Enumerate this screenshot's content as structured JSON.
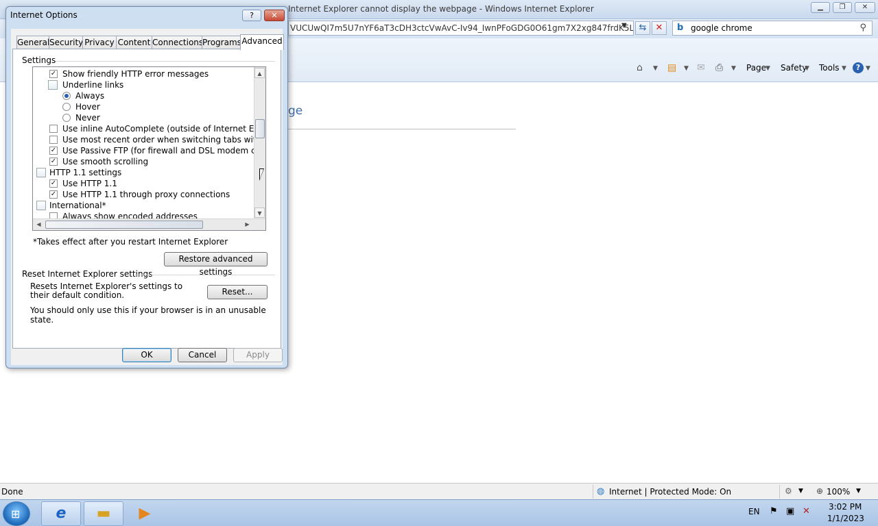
{
  "browser": {
    "title_fragment": "Internet Explorer cannot display the webpage - Windows Internet Explorer",
    "address": "VUCUwQI7m5U7nYF6aT3cDH3ctcVwAvC-Iv94_IwnPFoGDG0O61gm7X2xg847frdK5LIM4w-v",
    "search_query": "google chrome",
    "commands": {
      "page": "Page",
      "safety": "Safety",
      "tools": "Tools"
    },
    "page_heading_fragment": "ge",
    "status": {
      "done": "Done",
      "zone": "Internet | Protected Mode: On",
      "zoom": "100%"
    }
  },
  "dialog": {
    "title": "Internet Options",
    "help": "?",
    "close": "✕",
    "tabs": [
      "General",
      "Security",
      "Privacy",
      "Content",
      "Connections",
      "Programs",
      "Advanced"
    ],
    "settings_label": "Settings",
    "tree_items": [
      {
        "type": "checkbox",
        "checked": true,
        "label": "Show friendly HTTP error messages"
      },
      {
        "type": "folder",
        "label": "Underline links"
      },
      {
        "type": "radio",
        "checked": true,
        "label": "Always"
      },
      {
        "type": "radio",
        "checked": false,
        "label": "Hover"
      },
      {
        "type": "radio",
        "checked": false,
        "label": "Never"
      },
      {
        "type": "checkbox",
        "checked": false,
        "label": "Use inline AutoComplete (outside of Internet Explorer)"
      },
      {
        "type": "checkbox",
        "checked": false,
        "label": "Use most recent order when switching tabs with Ctrl+Tab"
      },
      {
        "type": "checkbox",
        "checked": true,
        "label": "Use Passive FTP (for firewall and DSL modem compatibility"
      },
      {
        "type": "checkbox",
        "checked": true,
        "label": "Use smooth scrolling"
      },
      {
        "type": "page",
        "label": "HTTP 1.1 settings"
      },
      {
        "type": "checkbox",
        "checked": true,
        "label": "Use HTTP 1.1"
      },
      {
        "type": "checkbox",
        "checked": true,
        "label": "Use HTTP 1.1 through proxy connections"
      },
      {
        "type": "folder",
        "label": "International*"
      },
      {
        "type": "checkbox",
        "checked": false,
        "label": "Always show encoded addresses"
      }
    ],
    "restart_note": "*Takes effect after you restart Internet Explorer",
    "restore_button": "Restore advanced settings",
    "reset_group_label": "Reset Internet Explorer settings",
    "reset_description": "Resets Internet Explorer's settings to their default condition.",
    "reset_button": "Reset...",
    "reset_warning": "You should only use this if your browser is in an unusable state.",
    "ok": "OK",
    "cancel": "Cancel",
    "apply": "Apply"
  },
  "taskbar": {
    "language": "EN",
    "time": "3:02 PM",
    "date": "1/1/2023"
  }
}
